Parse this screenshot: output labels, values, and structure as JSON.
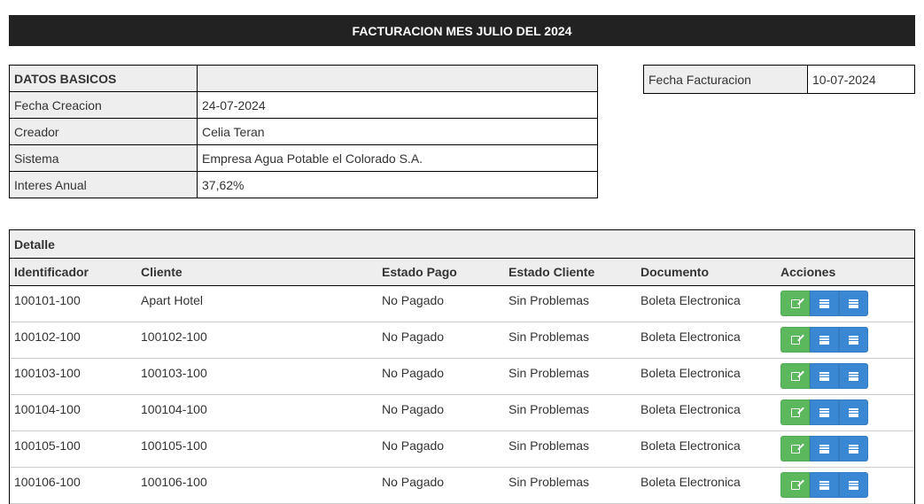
{
  "page_title": "FACTURACION MES JULIO DEL 2024",
  "basic": {
    "header": "DATOS BASICOS",
    "rows": [
      {
        "label": "Fecha Creacion",
        "value": "24-07-2024"
      },
      {
        "label": "Creador",
        "value": "Celia Teran"
      },
      {
        "label": "Sistema",
        "value": "Empresa Agua Potable el Colorado S.A."
      },
      {
        "label": "Interes Anual",
        "value": "37,62%"
      }
    ]
  },
  "billing_date": {
    "label": "Fecha Facturacion",
    "value": "10-07-2024"
  },
  "detail": {
    "title": "Detalle",
    "columns": [
      "Identificador",
      "Cliente",
      "Estado Pago",
      "Estado Cliente",
      "Documento",
      "Acciones"
    ],
    "rows": [
      [
        "100101-100",
        "Apart Hotel",
        "No Pagado",
        "Sin Problemas",
        "Boleta Electronica"
      ],
      [
        "100102-100",
        "100102-100",
        "No Pagado",
        "Sin Problemas",
        "Boleta Electronica"
      ],
      [
        "100103-100",
        "100103-100",
        "No Pagado",
        "Sin Problemas",
        "Boleta Electronica"
      ],
      [
        "100104-100",
        "100104-100",
        "No Pagado",
        "Sin Problemas",
        "Boleta Electronica"
      ],
      [
        "100105-100",
        "100105-100",
        "No Pagado",
        "Sin Problemas",
        "Boleta Electronica"
      ],
      [
        "100106-100",
        "100106-100",
        "No Pagado",
        "Sin Problemas",
        "Boleta Electronica"
      ]
    ],
    "action_icons": [
      "edit-icon",
      "list-icon",
      "list-icon"
    ]
  },
  "colors": {
    "title_bg": "#222222",
    "edit_button": "#5cb85c",
    "list_button": "#3a87d4",
    "header_bg": "#eeeeee"
  }
}
